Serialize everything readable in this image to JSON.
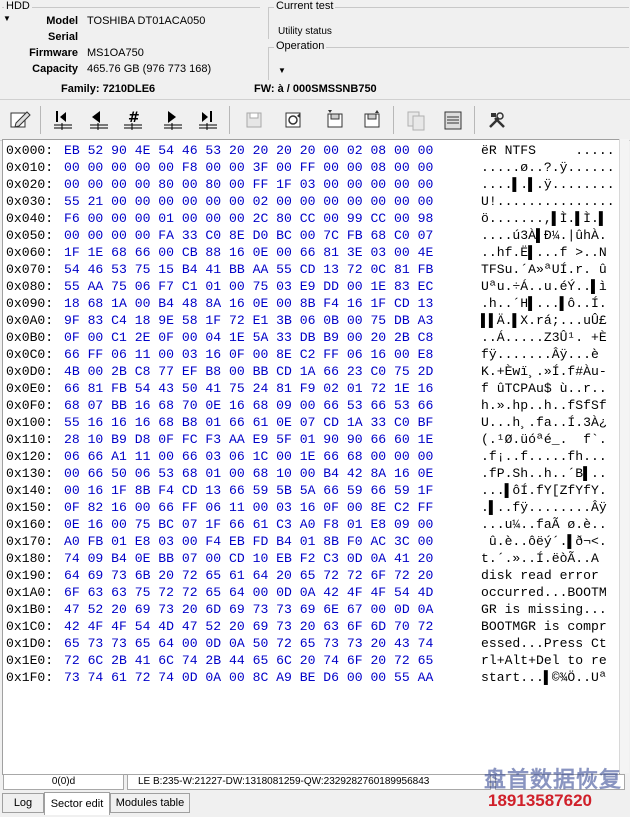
{
  "hdd": {
    "title": "HDD",
    "fields": [
      {
        "label": "Model",
        "value": "TOSHIBA DT01ACA050"
      },
      {
        "label": "Serial",
        "value": ""
      },
      {
        "label": "Firmware",
        "value": "MS1OA750"
      },
      {
        "label": "Capacity",
        "value": "465.76 GB (976 773 168)"
      }
    ]
  },
  "current_test": {
    "title": "Current test",
    "status": "Utility status"
  },
  "operation": {
    "title": "Operation",
    "value": ""
  },
  "info": {
    "family": "Family: 7210DLE6",
    "fw": "FW: à  / 000SMSSNB750"
  },
  "toolbar": {
    "buttons": [
      {
        "name": "edit-icon"
      },
      {
        "name": "first-sector-icon"
      },
      {
        "name": "prev-sector-icon"
      },
      {
        "name": "goto-sector-icon"
      },
      {
        "name": "next-sector-icon"
      },
      {
        "name": "last-sector-icon"
      },
      {
        "name": "save-disabled-icon"
      },
      {
        "name": "refresh-icon"
      },
      {
        "name": "write-sector-icon"
      },
      {
        "name": "read-sector-icon"
      },
      {
        "name": "copy-disabled-icon"
      },
      {
        "name": "disk-image-icon"
      },
      {
        "name": "tools-icon"
      }
    ]
  },
  "hex_rows": [
    {
      "addr": "0x000:",
      "hex": "EB 52 90 4E 54 46 53 20 20 20 20 00 02 08 00 00",
      "ascii": "ëR NTFS     ....."
    },
    {
      "addr": "0x010:",
      "hex": "00 00 00 00 00 F8 00 00 3F 00 FF 00 00 08 00 00",
      "ascii": ".....ø..?.ÿ......"
    },
    {
      "addr": "0x020:",
      "hex": "00 00 00 00 80 00 80 00 FF 1F 03 00 00 00 00 00",
      "ascii": "....▌.▌.ÿ........"
    },
    {
      "addr": "0x030:",
      "hex": "55 21 00 00 00 00 00 00 02 00 00 00 00 00 00 00",
      "ascii": "U!..............."
    },
    {
      "addr": "0x040:",
      "hex": "F6 00 00 00 01 00 00 00 2C 80 CC 00 99 CC 00 98",
      "ascii": "ö.......,▌Ì.▌Ì.▌"
    },
    {
      "addr": "0x050:",
      "hex": "00 00 00 00 FA 33 C0 8E D0 BC 00 7C FB 68 C0 07",
      "ascii": "....ú3À▌Ð¼.|ûhÀ."
    },
    {
      "addr": "0x060:",
      "hex": "1F 1E 68 66 00 CB 88 16 0E 00 66 81 3E 03 00 4E",
      "ascii": "..hf.Ë▌...f >..N"
    },
    {
      "addr": "0x070:",
      "hex": "54 46 53 75 15 B4 41 BB AA 55 CD 13 72 0C 81 FB",
      "ascii": "TFSu.´A»ªUÍ.r. û"
    },
    {
      "addr": "0x080:",
      "hex": "55 AA 75 06 F7 C1 01 00 75 03 E9 DD 00 1E 83 EC",
      "ascii": "Uªu.÷Á..u.éÝ..▌ì"
    },
    {
      "addr": "0x090:",
      "hex": "18 68 1A 00 B4 48 8A 16 0E 00 8B F4 16 1F CD 13",
      "ascii": ".h..´H▌...▌ô..Í."
    },
    {
      "addr": "0x0A0:",
      "hex": "9F 83 C4 18 9E 58 1F 72 E1 3B 06 0B 00 75 DB A3",
      "ascii": "▌▌Ä.▌X.rá;...uÛ£"
    },
    {
      "addr": "0x0B0:",
      "hex": "0F 00 C1 2E 0F 00 04 1E 5A 33 DB B9 00 20 2B C8",
      "ascii": "..Á.....Z3Û¹. +È"
    },
    {
      "addr": "0x0C0:",
      "hex": "66 FF 06 11 00 03 16 0F 00 8E C2 FF 06 16 00 E8",
      "ascii": "fÿ.......Âÿ...è"
    },
    {
      "addr": "0x0D0:",
      "hex": "4B 00 2B C8 77 EF B8 00 BB CD 1A 66 23 C0 75 2D",
      "ascii": "K.+Èwï¸.»Í.f#Àu-"
    },
    {
      "addr": "0x0E0:",
      "hex": "66 81 FB 54 43 50 41 75 24 81 F9 02 01 72 1E 16",
      "ascii": "f ûTCPAu$ ù..r.."
    },
    {
      "addr": "0x0F0:",
      "hex": "68 07 BB 16 68 70 0E 16 68 09 00 66 53 66 53 66",
      "ascii": "h.».hp..h..fSfSf"
    },
    {
      "addr": "0x100:",
      "hex": "55 16 16 16 68 B8 01 66 61 0E 07 CD 1A 33 C0 BF",
      "ascii": "U...h¸.fa..Í.3À¿"
    },
    {
      "addr": "0x110:",
      "hex": "28 10 B9 D8 0F FC F3 AA E9 5F 01 90 90 66 60 1E",
      "ascii": "(.¹Ø.üóªé_.  f`."
    },
    {
      "addr": "0x120:",
      "hex": "06 66 A1 11 00 66 03 06 1C 00 1E 66 68 00 00 00",
      "ascii": ".f¡..f.....fh..."
    },
    {
      "addr": "0x130:",
      "hex": "00 66 50 06 53 68 01 00 68 10 00 B4 42 8A 16 0E",
      "ascii": ".fP.Sh..h..´B▌.."
    },
    {
      "addr": "0x140:",
      "hex": "00 16 1F 8B F4 CD 13 66 59 5B 5A 66 59 66 59 1F",
      "ascii": "...▌ôÍ.fY[ZfYfY."
    },
    {
      "addr": "0x150:",
      "hex": "0F 82 16 00 66 FF 06 11 00 03 16 0F 00 8E C2 FF",
      "ascii": ".▌..fÿ........Âÿ"
    },
    {
      "addr": "0x160:",
      "hex": "0E 16 00 75 BC 07 1F 66 61 C3 A0 F8 01 E8 09 00",
      "ascii": "...u¼..faÃ ø.è.."
    },
    {
      "addr": "0x170:",
      "hex": "A0 FB 01 E8 03 00 F4 EB FD B4 01 8B F0 AC 3C 00",
      "ascii": " û.è..ôëý´.▌ð¬<."
    },
    {
      "addr": "0x180:",
      "hex": "74 09 B4 0E BB 07 00 CD 10 EB F2 C3 0D 0A 41 20",
      "ascii": "t.´.»..Í.ëòÃ..A "
    },
    {
      "addr": "0x190:",
      "hex": "64 69 73 6B 20 72 65 61 64 20 65 72 72 6F 72 20",
      "ascii": "disk read error "
    },
    {
      "addr": "0x1A0:",
      "hex": "6F 63 63 75 72 72 65 64 00 0D 0A 42 4F 4F 54 4D",
      "ascii": "occurred...BOOTM"
    },
    {
      "addr": "0x1B0:",
      "hex": "47 52 20 69 73 20 6D 69 73 73 69 6E 67 00 0D 0A",
      "ascii": "GR is missing..."
    },
    {
      "addr": "0x1C0:",
      "hex": "42 4F 4F 54 4D 47 52 20 69 73 20 63 6F 6D 70 72",
      "ascii": "BOOTMGR is compr"
    },
    {
      "addr": "0x1D0:",
      "hex": "65 73 73 65 64 00 0D 0A 50 72 65 73 73 20 43 74",
      "ascii": "essed...Press Ct"
    },
    {
      "addr": "0x1E0:",
      "hex": "72 6C 2B 41 6C 74 2B 44 65 6C 20 74 6F 20 72 65",
      "ascii": "rl+Alt+Del to re"
    },
    {
      "addr": "0x1F0:",
      "hex": "73 74 61 72 74 0D 0A 00 8C A9 BE D6 00 00 55 AA",
      "ascii": "start...▌©¾Ö..Uª"
    }
  ],
  "status": {
    "position": "0(0)d",
    "values": "LE B:235-W:21227-DW:1318081259-QW:2329282760189956843"
  },
  "tabs": [
    {
      "label": "Log"
    },
    {
      "label": "Sector edit"
    },
    {
      "label": "Modules table"
    }
  ],
  "watermark": {
    "name": "盘首数据恢复",
    "phone": "18913587620"
  },
  "colors": {
    "hex_text": "#0000c8",
    "accent_dark": "#000000"
  }
}
